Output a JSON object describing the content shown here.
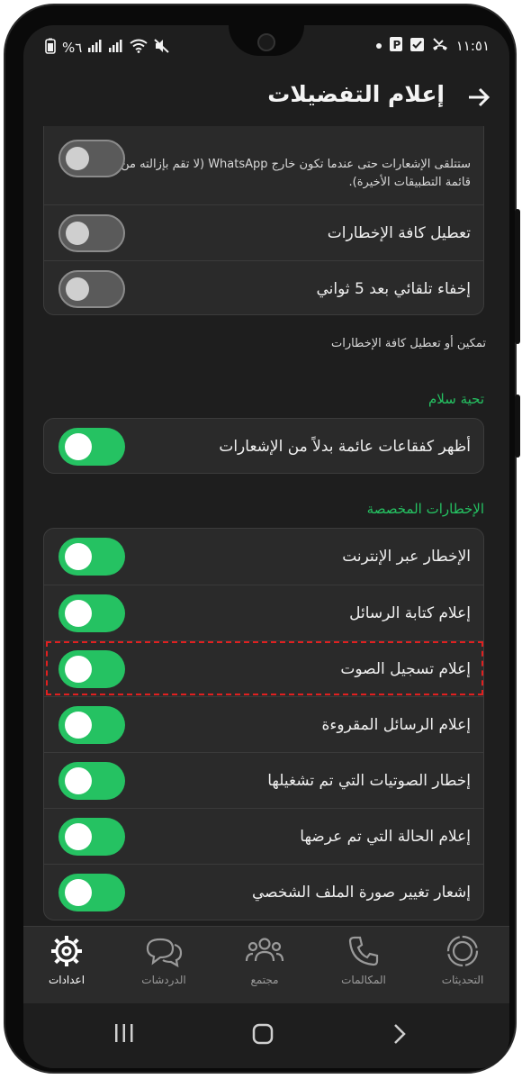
{
  "status": {
    "left": [
      "%٦",
      "signal-bars",
      "signal-bars",
      "wifi",
      "mute"
    ],
    "time": "١١:٥١"
  },
  "header": {
    "title": "إعلام التفضيلات"
  },
  "top_card": {
    "partial_row_desc": "ستتلقى الإشعارات حتى عندما تكون خارج WhatsApp (لا تقم بإزالته من قائمة التطبيقات الأخيرة).",
    "rows": [
      {
        "label": "تعطيل كافة الإخطارات",
        "on": false
      },
      {
        "label": "إخفاء تلقائي بعد 5 ثواني",
        "on": false
      }
    ],
    "footer_note": "تمكين أو تعطيل كافة الإخطارات"
  },
  "greeting_section": {
    "heading": "تحية سلام",
    "rows": [
      {
        "label": "أظهر كفقاعات عائمة بدلاً من الإشعارات",
        "on": true
      }
    ]
  },
  "custom_section": {
    "heading": "الإخطارات المخصصة",
    "rows": [
      {
        "label": "الإخطار عبر الإنترنت",
        "on": true
      },
      {
        "label": "إعلام كتابة الرسائل",
        "on": true
      },
      {
        "label": "إعلام تسجيل الصوت",
        "on": true
      },
      {
        "label": "إعلام الرسائل المقروءة",
        "on": true
      },
      {
        "label": "إخطار الصوتيات التي تم تشغيلها",
        "on": true
      },
      {
        "label": "إعلام الحالة التي تم عرضها",
        "on": true
      },
      {
        "label": "إشعار تغيير صورة الملف الشخصي",
        "on": true
      }
    ]
  },
  "bottom_nav": {
    "items": [
      {
        "label": "اعدادات",
        "icon": "settings-gear-icon",
        "active": true
      },
      {
        "label": "الدردشات",
        "icon": "chats-icon",
        "active": false
      },
      {
        "label": "مجتمع",
        "icon": "community-icon",
        "active": false
      },
      {
        "label": "المكالمات",
        "icon": "phone-icon",
        "active": false
      },
      {
        "label": "التحديثات",
        "icon": "updates-icon",
        "active": false
      }
    ]
  },
  "colors": {
    "accent": "#25c262",
    "background": "#1e1e1e",
    "card": "#2a2a2a",
    "highlight": "#e02020"
  }
}
